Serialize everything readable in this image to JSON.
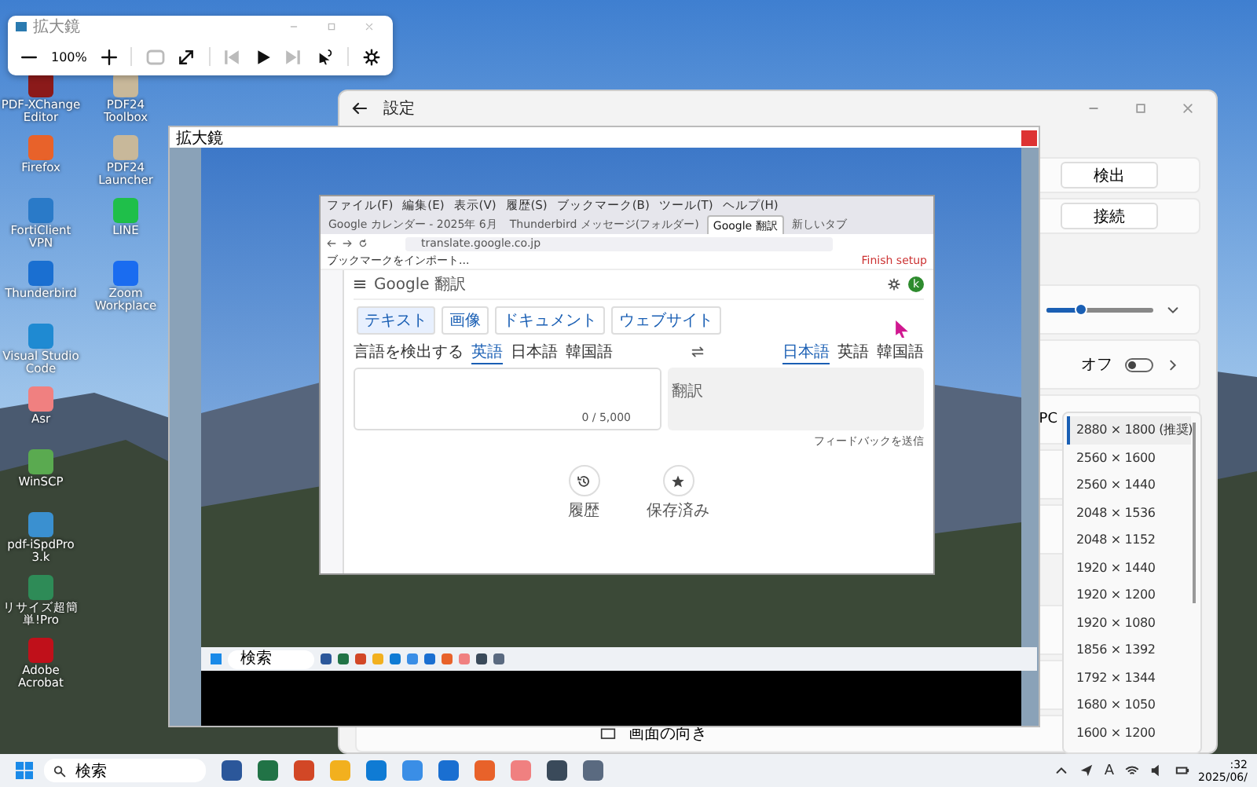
{
  "magnifier_toolbar": {
    "title": "拡大鏡",
    "zoom": "100%"
  },
  "desktop_icons": [
    [
      {
        "label": "PDF-XChange Editor",
        "color": "#8b1a1a"
      },
      {
        "label": "PDF24 Toolbox",
        "color": "#c8b89a"
      }
    ],
    [
      {
        "label": "Firefox",
        "color": "#e8622a"
      },
      {
        "label": "PDF24 Launcher",
        "color": "#c8b89a"
      }
    ],
    [
      {
        "label": "FortiClient VPN",
        "color": "#2a7ac8"
      },
      {
        "label": "LINE",
        "color": "#1fbf4a"
      }
    ],
    [
      {
        "label": "Thunderbird",
        "color": "#1a6fd1"
      },
      {
        "label": "Zoom Workplace",
        "color": "#1a6cf0"
      }
    ],
    [
      {
        "label": "Visual Studio Code",
        "color": "#1f8ad2"
      }
    ],
    [
      {
        "label": "Asr",
        "color": "#f08080"
      }
    ],
    [
      {
        "label": "WinSCP",
        "color": "#5aaa50"
      }
    ],
    [
      {
        "label": "pdf-iSpdPro 3.k",
        "color": "#3a90d0"
      }
    ],
    [
      {
        "label": "リサイズ超簡単!Pro",
        "color": "#2e8b57"
      }
    ],
    [
      {
        "label": "Adobe Acrobat",
        "color": "#c0101a"
      }
    ]
  ],
  "settings_window": {
    "title": "設定",
    "buttons": [
      "検出",
      "接続"
    ],
    "slider": {
      "level": 0.32
    },
    "toggle": {
      "label": "オフ",
      "on": false
    },
    "display_label": "PC",
    "orientation_label": "画面の向き",
    "resolutions": [
      {
        "label": "2880 × 1800 (推奨)",
        "selected": true
      },
      {
        "label": "2560 × 1600",
        "selected": false
      },
      {
        "label": "2560 × 1440",
        "selected": false
      },
      {
        "label": "2048 × 1536",
        "selected": false
      },
      {
        "label": "2048 × 1152",
        "selected": false
      },
      {
        "label": "1920 × 1440",
        "selected": false
      },
      {
        "label": "1920 × 1200",
        "selected": false
      },
      {
        "label": "1920 × 1080",
        "selected": false
      },
      {
        "label": "1856 × 1392",
        "selected": false
      },
      {
        "label": "1792 × 1344",
        "selected": false
      },
      {
        "label": "1680 × 1050",
        "selected": false
      },
      {
        "label": "1600 × 1200",
        "selected": false
      }
    ]
  },
  "magnifier_window": {
    "title": "拡大鏡",
    "browser": {
      "menu": [
        "ファイル(F)",
        "編集(E)",
        "表示(V)",
        "履歴(S)",
        "ブックマーク(B)",
        "ツール(T)",
        "ヘルプ(H)"
      ],
      "tabs": [
        {
          "label": "Google カレンダー - 2025年 6月",
          "selected": false
        },
        {
          "label": "Thunderbird メッセージ(フォルダー)",
          "selected": false
        },
        {
          "label": "Google 翻訳",
          "selected": true
        },
        {
          "label": "新しいタブ",
          "selected": false
        }
      ],
      "url": "translate.google.co.jp",
      "bookmark": "ブックマークをインポート...",
      "setup": "Finish setup",
      "app_title": "Google 翻訳",
      "avatar": "k",
      "modes": [
        {
          "label": "テキスト",
          "selected": true
        },
        {
          "label": "画像",
          "selected": false
        },
        {
          "label": "ドキュメント",
          "selected": false
        },
        {
          "label": "ウェブサイト",
          "selected": false
        }
      ],
      "source_langs": [
        {
          "label": "言語を検出する",
          "selected": false
        },
        {
          "label": "英語",
          "selected": true
        },
        {
          "label": "日本語",
          "selected": false
        },
        {
          "label": "韓国語",
          "selected": false
        }
      ],
      "target_langs": [
        {
          "label": "日本語",
          "selected": true
        },
        {
          "label": "英語",
          "selected": false
        },
        {
          "label": "韓国語",
          "selected": false
        }
      ],
      "counter": "0 / 5,000",
      "output_placeholder": "翻訳",
      "feedback": "フィードバックを送信",
      "history": "履歴",
      "saved": "保存済み"
    },
    "inner_taskbar": {
      "search": "検索"
    }
  },
  "taskbar": {
    "search": "検索",
    "ime": "A",
    "time": ":32",
    "date": "2025/06/"
  }
}
